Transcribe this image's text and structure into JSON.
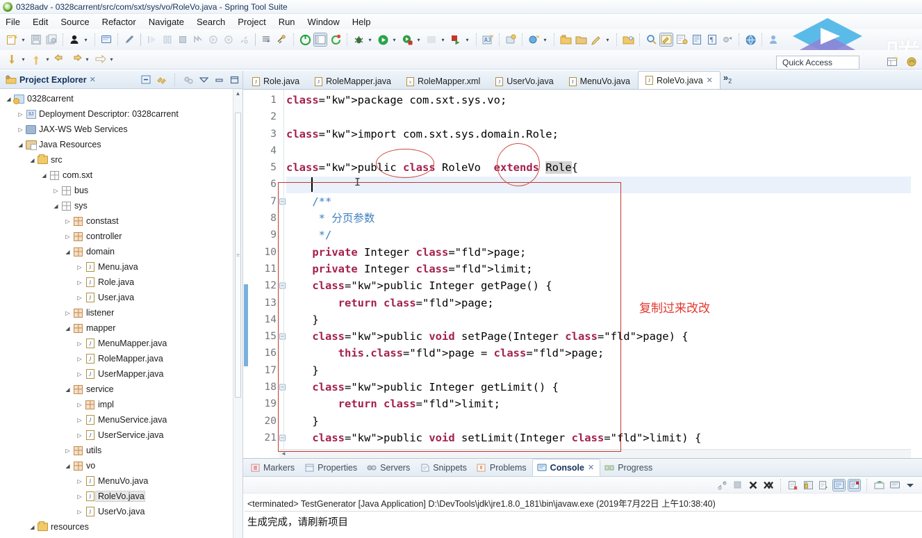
{
  "window": {
    "title": "0328adv - 0328carrent/src/com/sxt/sys/vo/RoleVo.java - Spring Tool Suite",
    "app_icon": "spring-tool-suite-icon"
  },
  "menubar": {
    "items": [
      "File",
      "Edit",
      "Source",
      "Refactor",
      "Navigate",
      "Search",
      "Project",
      "Run",
      "Window",
      "Help"
    ]
  },
  "toolbar": {
    "quick_access_placeholder": "Quick Access",
    "icons": [
      "new-wizard-icon",
      "save-icon",
      "save-all-icon",
      "debug-person-icon",
      "console-view-icon",
      "undo-pen-icon",
      "step-into-icon",
      "step-over-icon",
      "terminate-icon",
      "skip-breakpoints-icon",
      "resume-icon",
      "suspend-icon",
      "disconnect-icon",
      "open-type-icon",
      "open-task-icon",
      "spring-boot-icon",
      "open-editor-icon",
      "refresh-icon",
      "debug-bug-icon",
      "run-icon",
      "coverage-icon",
      "external-tools-icon",
      "run-last-icon",
      "new-java-project-icon",
      "new-package-icon",
      "new-class-icon",
      "new-folder-icon",
      "new-file-icon",
      "search-icon",
      "javadoc-icon",
      "marker-icon",
      "task-icon",
      "annotation-icon",
      "sync-icon",
      "web-icon",
      "user-icon"
    ],
    "row2_icons": [
      "down-arrow-yellow-icon",
      "up-arrow-yellow-icon",
      "back-icon",
      "forward-icon",
      "next-icon"
    ]
  },
  "explorer": {
    "title": "Project Explorer",
    "close_glyph": "✕",
    "toolbar_icons": [
      "collapse-all-icon",
      "link-with-editor-icon",
      "view-filter-icon",
      "view-menu-icon",
      "minimize-icon",
      "maximize-icon"
    ],
    "tree": [
      {
        "label": "0328carrent",
        "indent": 0,
        "twisty": "down",
        "icon": "project-icon"
      },
      {
        "label": "Deployment Descriptor: 0328carrent",
        "indent": 1,
        "twisty": "right",
        "icon": "deployment-descriptor-icon"
      },
      {
        "label": "JAX-WS Web Services",
        "indent": 1,
        "twisty": "right",
        "icon": "web-services-icon"
      },
      {
        "label": "Java Resources",
        "indent": 1,
        "twisty": "down",
        "icon": "java-resources-icon"
      },
      {
        "label": "src",
        "indent": 2,
        "twisty": "down",
        "icon": "source-folder-icon"
      },
      {
        "label": "com.sxt",
        "indent": 3,
        "twisty": "down",
        "icon": "package-empty-icon"
      },
      {
        "label": "bus",
        "indent": 4,
        "twisty": "right",
        "icon": "package-empty-icon"
      },
      {
        "label": "sys",
        "indent": 4,
        "twisty": "down",
        "icon": "package-empty-icon"
      },
      {
        "label": "constast",
        "indent": 5,
        "twisty": "right",
        "icon": "package-icon"
      },
      {
        "label": "controller",
        "indent": 5,
        "twisty": "right",
        "icon": "package-icon"
      },
      {
        "label": "domain",
        "indent": 5,
        "twisty": "down",
        "icon": "package-icon"
      },
      {
        "label": "Menu.java",
        "indent": 6,
        "twisty": "right",
        "icon": "java-file-icon"
      },
      {
        "label": "Role.java",
        "indent": 6,
        "twisty": "right",
        "icon": "java-file-icon"
      },
      {
        "label": "User.java",
        "indent": 6,
        "twisty": "right",
        "icon": "java-file-icon"
      },
      {
        "label": "listener",
        "indent": 5,
        "twisty": "right",
        "icon": "package-icon"
      },
      {
        "label": "mapper",
        "indent": 5,
        "twisty": "down",
        "icon": "package-icon"
      },
      {
        "label": "MenuMapper.java",
        "indent": 6,
        "twisty": "right",
        "icon": "java-interface-icon"
      },
      {
        "label": "RoleMapper.java",
        "indent": 6,
        "twisty": "right",
        "icon": "java-interface-icon"
      },
      {
        "label": "UserMapper.java",
        "indent": 6,
        "twisty": "right",
        "icon": "java-interface-icon"
      },
      {
        "label": "service",
        "indent": 5,
        "twisty": "down",
        "icon": "package-icon"
      },
      {
        "label": "impl",
        "indent": 6,
        "twisty": "right",
        "icon": "package-icon"
      },
      {
        "label": "MenuService.java",
        "indent": 6,
        "twisty": "right",
        "icon": "java-interface-icon"
      },
      {
        "label": "UserService.java",
        "indent": 6,
        "twisty": "right",
        "icon": "java-interface-icon"
      },
      {
        "label": "utils",
        "indent": 5,
        "twisty": "right",
        "icon": "package-icon"
      },
      {
        "label": "vo",
        "indent": 5,
        "twisty": "down",
        "icon": "package-icon"
      },
      {
        "label": "MenuVo.java",
        "indent": 6,
        "twisty": "right",
        "icon": "java-file-icon"
      },
      {
        "label": "RoleVo.java",
        "indent": 6,
        "twisty": "right",
        "icon": "java-file-icon",
        "selected": true
      },
      {
        "label": "UserVo.java",
        "indent": 6,
        "twisty": "right",
        "icon": "java-file-icon"
      },
      {
        "label": "resources",
        "indent": 2,
        "twisty": "down",
        "icon": "source-folder-icon"
      }
    ]
  },
  "editor": {
    "tabs": [
      {
        "label": "Role.java",
        "icon": "java-file-icon",
        "active": false
      },
      {
        "label": "RoleMapper.java",
        "icon": "java-file-icon",
        "active": false
      },
      {
        "label": "RoleMapper.xml",
        "icon": "xml-file-icon",
        "active": false
      },
      {
        "label": "UserVo.java",
        "icon": "java-file-icon",
        "active": false
      },
      {
        "label": "MenuVo.java",
        "icon": "java-file-icon",
        "active": false
      },
      {
        "label": "RoleVo.java",
        "icon": "java-file-icon",
        "active": true,
        "close_glyph": "✕"
      }
    ],
    "overflow_label": "»",
    "overflow_count": "2",
    "first_line": 1,
    "lines": [
      {
        "n": 1,
        "fold": false,
        "text": "package com.sxt.sys.vo;"
      },
      {
        "n": 2,
        "fold": false,
        "text": ""
      },
      {
        "n": 3,
        "fold": false,
        "text": "import com.sxt.sys.domain.Role;"
      },
      {
        "n": 4,
        "fold": false,
        "text": ""
      },
      {
        "n": 5,
        "fold": false,
        "text": "public class RoleVo  extends Role{"
      },
      {
        "n": 6,
        "fold": false,
        "text": ""
      },
      {
        "n": 7,
        "fold": true,
        "text": "    /**"
      },
      {
        "n": 8,
        "fold": false,
        "text": "     * 分页参数"
      },
      {
        "n": 9,
        "fold": false,
        "text": "     */"
      },
      {
        "n": 10,
        "fold": false,
        "text": "    private Integer page;"
      },
      {
        "n": 11,
        "fold": false,
        "text": "    private Integer limit;"
      },
      {
        "n": 12,
        "fold": true,
        "text": "    public Integer getPage() {"
      },
      {
        "n": 13,
        "fold": false,
        "text": "        return page;"
      },
      {
        "n": 14,
        "fold": false,
        "text": "    }"
      },
      {
        "n": 15,
        "fold": true,
        "text": "    public void setPage(Integer page) {"
      },
      {
        "n": 16,
        "fold": false,
        "text": "        this.page = page;"
      },
      {
        "n": 17,
        "fold": false,
        "text": "    }"
      },
      {
        "n": 18,
        "fold": true,
        "text": "    public Integer getLimit() {"
      },
      {
        "n": 19,
        "fold": false,
        "text": "        return limit;"
      },
      {
        "n": 20,
        "fold": false,
        "text": "    }"
      },
      {
        "n": 21,
        "fold": true,
        "text": "    public void setLimit(Integer limit) {"
      }
    ],
    "caret_line": 6
  },
  "annotations": {
    "note_text": "复制过来改改",
    "circle_labels": [
      "RoleVo",
      "Role"
    ],
    "box_color": "#c0392b",
    "circle_color": "#d04a3d",
    "text_color": "#e03a2f"
  },
  "bottom_panel": {
    "tabs": [
      {
        "label": "Markers",
        "icon": "markers-icon",
        "active": false
      },
      {
        "label": "Properties",
        "icon": "properties-icon",
        "active": false
      },
      {
        "label": "Servers",
        "icon": "servers-icon",
        "active": false
      },
      {
        "label": "Snippets",
        "icon": "snippets-icon",
        "active": false
      },
      {
        "label": "Problems",
        "icon": "problems-icon",
        "active": false
      },
      {
        "label": "Console",
        "icon": "console-icon",
        "active": true,
        "close_glyph": "✕"
      },
      {
        "label": "Progress",
        "icon": "progress-icon",
        "active": false
      }
    ],
    "toolbar_icons": [
      "pin-console-icon",
      "terminate-icon",
      "remove-launch-icon",
      "remove-all-launches-icon",
      "clear-console-icon",
      "scroll-lock-icon",
      "word-wrap-icon",
      "show-console-on-output-icon",
      "show-console-on-error-icon",
      "open-console-icon",
      "display-selected-console-icon",
      "view-menu-icon"
    ],
    "console": {
      "header": "<terminated> TestGenerator [Java Application] D:\\DevTools\\jdk\\jre1.8.0_181\\bin\\javaw.exe (2019年7月22日 上午10:38:40)",
      "output": "生成完成，请刷新项目"
    }
  }
}
